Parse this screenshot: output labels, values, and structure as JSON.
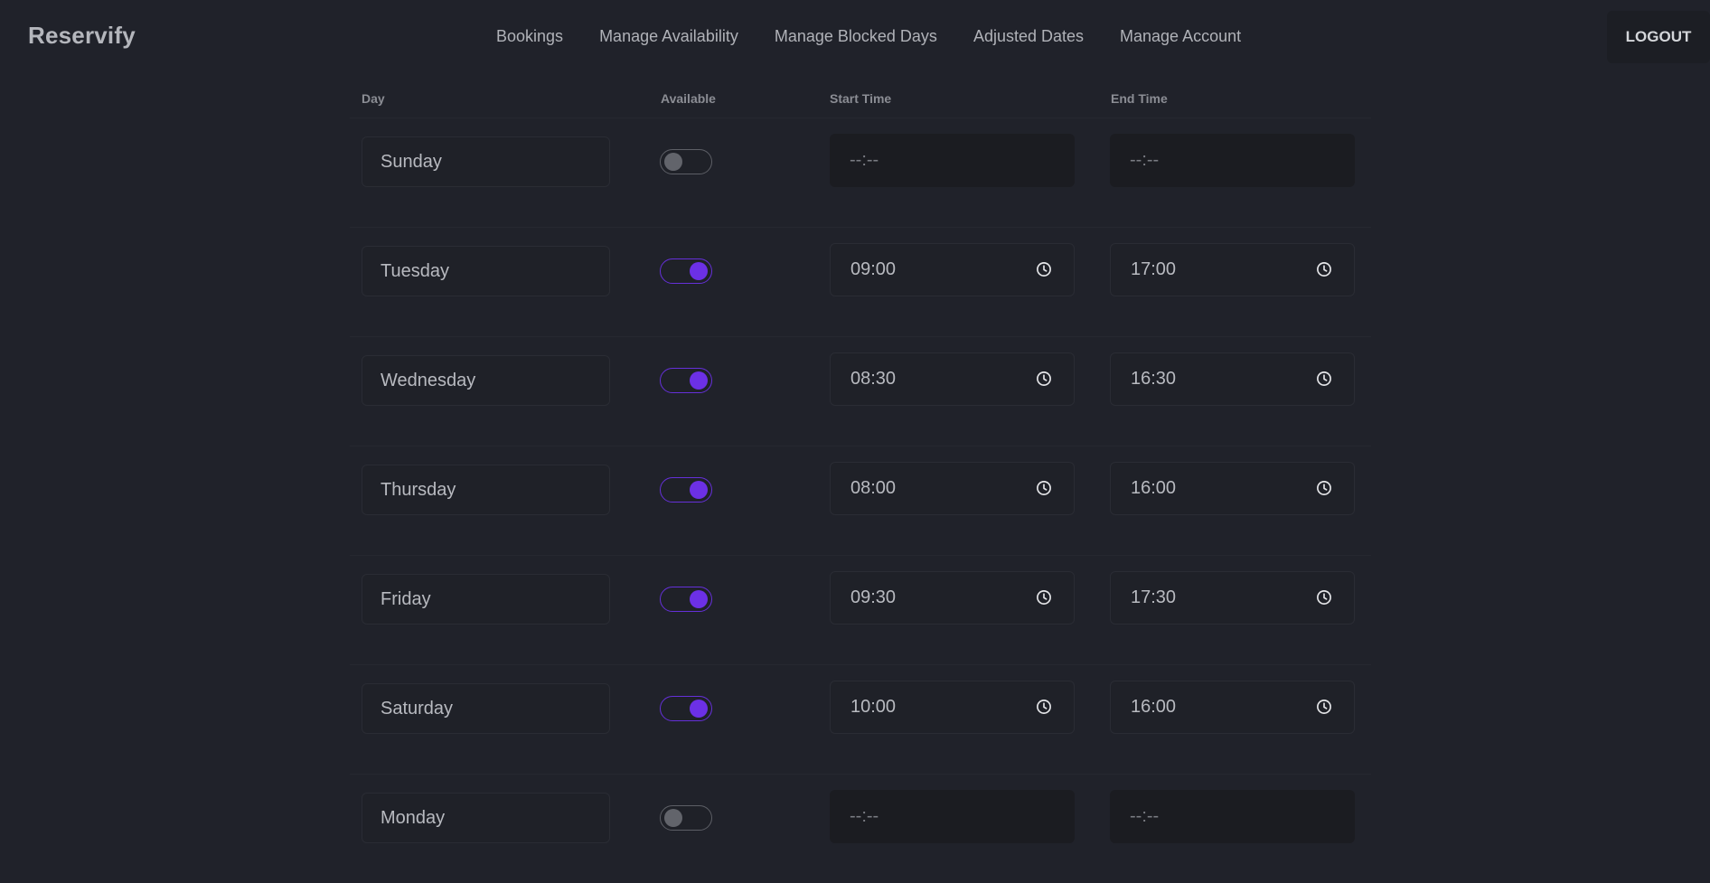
{
  "app": {
    "brand": "Reservify"
  },
  "nav": {
    "links": [
      "Bookings",
      "Manage Availability",
      "Manage Blocked Days",
      "Adjusted Dates",
      "Manage Account"
    ],
    "logout": "LOGOUT"
  },
  "table": {
    "headers": {
      "day": "Day",
      "available": "Available",
      "start": "Start Time",
      "end": "End Time"
    },
    "rows": [
      {
        "day": "Sunday",
        "available": false,
        "start": "--:--",
        "end": "--:--"
      },
      {
        "day": "Tuesday",
        "available": true,
        "start": "09:00",
        "end": "17:00"
      },
      {
        "day": "Wednesday",
        "available": true,
        "start": "08:30",
        "end": "16:30"
      },
      {
        "day": "Thursday",
        "available": true,
        "start": "08:00",
        "end": "16:00"
      },
      {
        "day": "Friday",
        "available": true,
        "start": "09:30",
        "end": "17:30"
      },
      {
        "day": "Saturday",
        "available": true,
        "start": "10:00",
        "end": "16:00"
      },
      {
        "day": "Monday",
        "available": false,
        "start": "--:--",
        "end": "--:--"
      }
    ]
  },
  "colors": {
    "background": "#20222a",
    "accent": "#6c30e6",
    "toggle_off": "#62646b"
  }
}
